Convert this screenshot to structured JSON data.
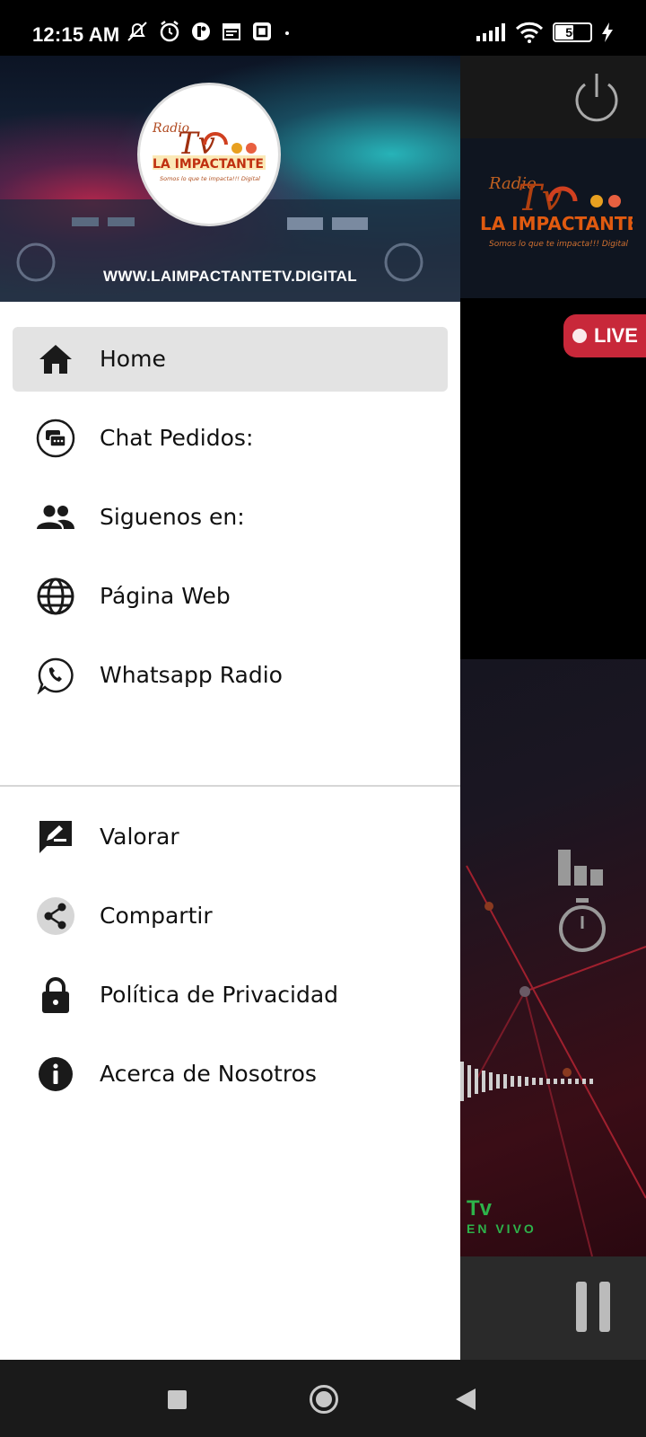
{
  "status_bar": {
    "time": "12:15 AM",
    "battery_level": "50"
  },
  "drawer": {
    "header_url": "WWW.LAIMPACTANTETV.DIGITAL",
    "logo_text": {
      "top": "Radio",
      "big": "Tv",
      "brand": "LA IMPACTANTE",
      "tagline": "Somos lo que te impacta!!! Digital"
    },
    "menu_primary": [
      {
        "label": "Home",
        "icon": "home-icon",
        "active": true
      },
      {
        "label": "Chat Pedidos:",
        "icon": "chat-icon",
        "active": false
      },
      {
        "label": "Siguenos en:",
        "icon": "people-icon",
        "active": false
      },
      {
        "label": "Página Web",
        "icon": "globe-icon",
        "active": false
      },
      {
        "label": "Whatsapp Radio",
        "icon": "whatsapp-icon",
        "active": false
      }
    ],
    "menu_secondary": [
      {
        "label": "Valorar",
        "icon": "rate-icon"
      },
      {
        "label": "Compartir",
        "icon": "share-icon"
      },
      {
        "label": "Política de Privacidad",
        "icon": "lock-icon"
      },
      {
        "label": "Acerca de Nosotros",
        "icon": "info-icon"
      }
    ]
  },
  "background_app": {
    "live_label": "LIVE",
    "tv_label": "Tv",
    "en_vivo_label": "EN VIVO"
  },
  "colors": {
    "active_item_bg": "#e3e3e3",
    "live_red": "#c8283a",
    "en_vivo_green": "#2db34a"
  }
}
